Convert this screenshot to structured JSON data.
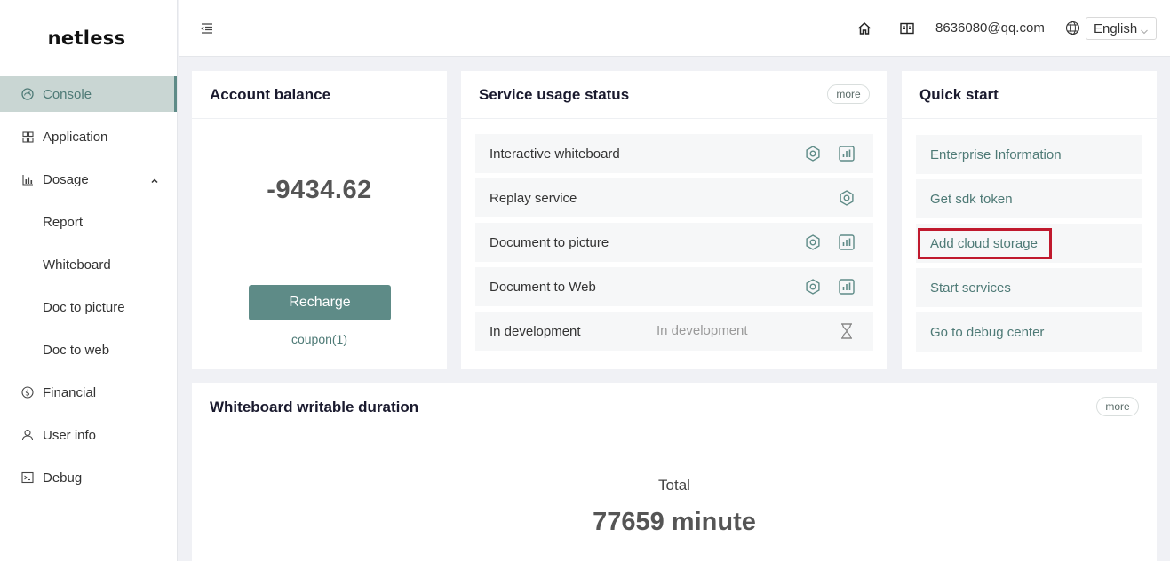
{
  "brand": {
    "logo_text": "netless"
  },
  "sidebar": {
    "items": [
      {
        "label": "Console",
        "icon": "dashboard-icon",
        "active": true
      },
      {
        "label": "Application",
        "icon": "grid-icon"
      },
      {
        "label": "Dosage",
        "icon": "bar-chart-icon",
        "expanded": true
      },
      {
        "label": "Report",
        "sub": true
      },
      {
        "label": "Whiteboard",
        "sub": true
      },
      {
        "label": "Doc to picture",
        "sub": true
      },
      {
        "label": "Doc to web",
        "sub": true
      },
      {
        "label": "Financial",
        "icon": "dollar-icon"
      },
      {
        "label": "User info",
        "icon": "user-icon"
      },
      {
        "label": "Debug",
        "icon": "terminal-icon"
      }
    ]
  },
  "header": {
    "email": "8636080@qq.com",
    "language": "English"
  },
  "account_balance": {
    "title": "Account balance",
    "amount": "-9434.62",
    "recharge_label": "Recharge",
    "coupon_label": "coupon(1)"
  },
  "service_usage": {
    "title": "Service usage status",
    "more_label": "more",
    "rows": [
      {
        "label": "Interactive whiteboard",
        "extra": "",
        "icons": [
          "gear-icon",
          "stats-icon"
        ]
      },
      {
        "label": "Replay service",
        "extra": "",
        "icons": [
          "gear-icon"
        ]
      },
      {
        "label": "Document to picture",
        "extra": "",
        "icons": [
          "gear-icon",
          "stats-icon"
        ]
      },
      {
        "label": "Document to Web",
        "extra": "",
        "icons": [
          "gear-icon",
          "stats-icon"
        ]
      },
      {
        "label": "In development",
        "extra": "In development",
        "icons": [
          "hourglass-icon"
        ]
      }
    ]
  },
  "quick_start": {
    "title": "Quick start",
    "items": [
      {
        "label": "Enterprise Information"
      },
      {
        "label": "Get sdk token"
      },
      {
        "label": "Add cloud storage",
        "highlighted": true
      },
      {
        "label": "Start services"
      },
      {
        "label": "Go to debug center"
      }
    ]
  },
  "whiteboard_duration": {
    "title": "Whiteboard writable duration",
    "more_label": "more",
    "total_label": "Total",
    "total_value": "77659 minute"
  },
  "colors": {
    "accent": "#5e8b87",
    "accent_light": "#c9d6d3",
    "highlight_box": "#c0192d",
    "background": "#f0f1f5"
  }
}
